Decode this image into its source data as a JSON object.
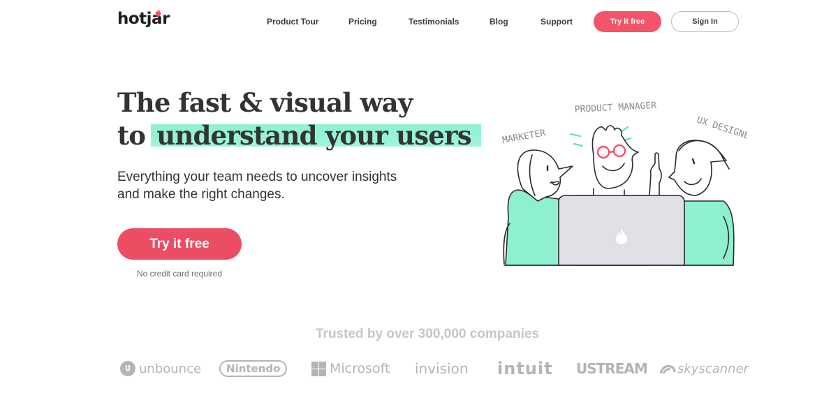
{
  "header": {
    "logo_text": "hotjar",
    "nav": [
      "Product Tour",
      "Pricing",
      "Testimonials",
      "Blog",
      "Support"
    ],
    "try_label": "Try it free",
    "signin_label": "Sign In"
  },
  "hero": {
    "headline_line1": "The fast & visual way",
    "headline_prefix": "to",
    "headline_highlight": "understand your users",
    "subtitle": "Everything your team needs to uncover insights and make the right changes.",
    "cta_label": "Try it free",
    "cta_note": "No credit card required",
    "illustration_labels": {
      "marketer": "MARKETER",
      "product_manager": "PRODUCT MANAGER",
      "ux_designer": "UX DESIGNER"
    }
  },
  "trusted": {
    "heading": "Trusted by over 300,000 companies",
    "logos": [
      "unbounce",
      "Nintendo",
      "Microsoft",
      "invision",
      "intuit",
      "USTREAM",
      "skyscanner"
    ]
  },
  "colors": {
    "brand_red": "#eb4d63",
    "highlight_green": "#9ff4d9",
    "illustration_green": "#8ef0cf",
    "logo_gray": "#b4b4b4"
  }
}
